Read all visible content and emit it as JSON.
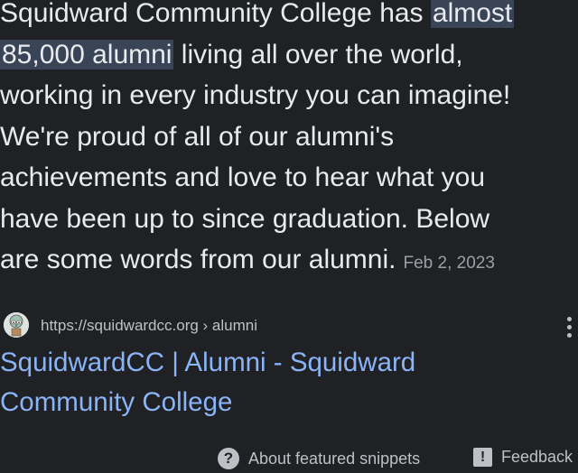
{
  "snippet": {
    "line1_text": "Squidward Community College has ",
    "line1_highlight": "almost",
    "line2_highlight": "85,000 alumni",
    "line2_text": " living all over the world,",
    "line3": "working in every industry you can imagine!",
    "line4": "We're proud of all of our alumni's",
    "line5": "achievements and love to hear what you",
    "line6": "have been up to since graduation. Below",
    "line7": "are some words from our alumni.",
    "date": "Feb 2, 2023"
  },
  "source": {
    "url": "https://squidwardcc.org",
    "breadcrumb": " › alumni",
    "favicon": "squidward-favicon-icon",
    "more_icon": "more-vert-icon"
  },
  "result": {
    "title_line1": "SquidwardCC | Alumni - Squidward",
    "title_line2": "Community College"
  },
  "footer": {
    "about_label": "About featured snippets",
    "about_icon": "?",
    "feedback_label": "Feedback",
    "feedback_icon": "!"
  },
  "colors": {
    "background": "#202124",
    "text": "#e8eaed",
    "highlight": "#394457",
    "link": "#8ab4f8",
    "muted": "#9aa0a6"
  }
}
